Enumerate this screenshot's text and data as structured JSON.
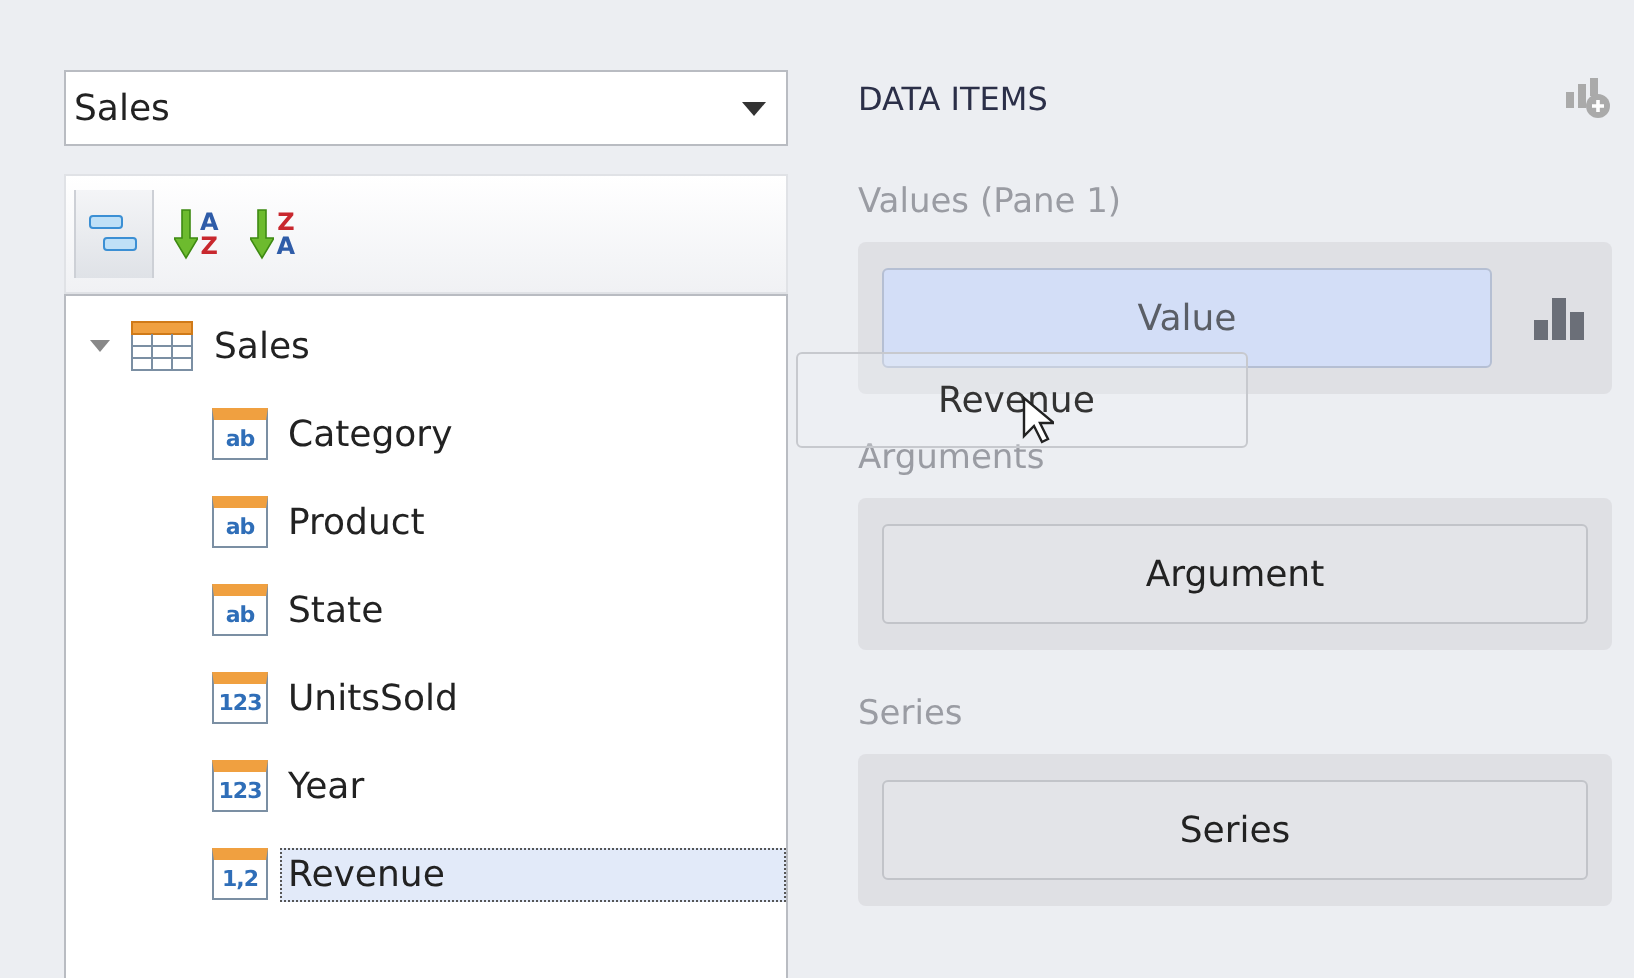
{
  "data_source": {
    "value": "Sales"
  },
  "toolbar": [
    {
      "kind": "group",
      "selected": true
    },
    {
      "kind": "sort_asc",
      "selected": false,
      "letters": [
        "A",
        "Z"
      ]
    },
    {
      "kind": "sort_desc",
      "selected": false,
      "letters": [
        "Z",
        "A"
      ]
    }
  ],
  "tree": [
    {
      "label": "Sales",
      "expanded": true,
      "selected": false,
      "children": [
        {
          "label": "Category",
          "badge": "ab",
          "selected": false
        },
        {
          "label": "Product",
          "badge": "ab",
          "selected": false
        },
        {
          "label": "State",
          "badge": "ab",
          "selected": false
        },
        {
          "label": "UnitsSold",
          "badge": "123",
          "selected": false
        },
        {
          "label": "Year",
          "badge": "123",
          "selected": false
        },
        {
          "label": "Revenue",
          "badge": "1,2",
          "selected": true
        }
      ]
    }
  ],
  "data_items": {
    "title": "DATA ITEMS",
    "sections": [
      {
        "label": "Values (Pane 1)",
        "kind": "value_slot",
        "placeholder": "Value",
        "highlighted": true
      },
      {
        "label": "Arguments",
        "kind": "button",
        "button": "Argument"
      },
      {
        "label": "Series",
        "kind": "button",
        "button": "Series"
      }
    ]
  },
  "drag": {
    "label": "Revenue"
  }
}
